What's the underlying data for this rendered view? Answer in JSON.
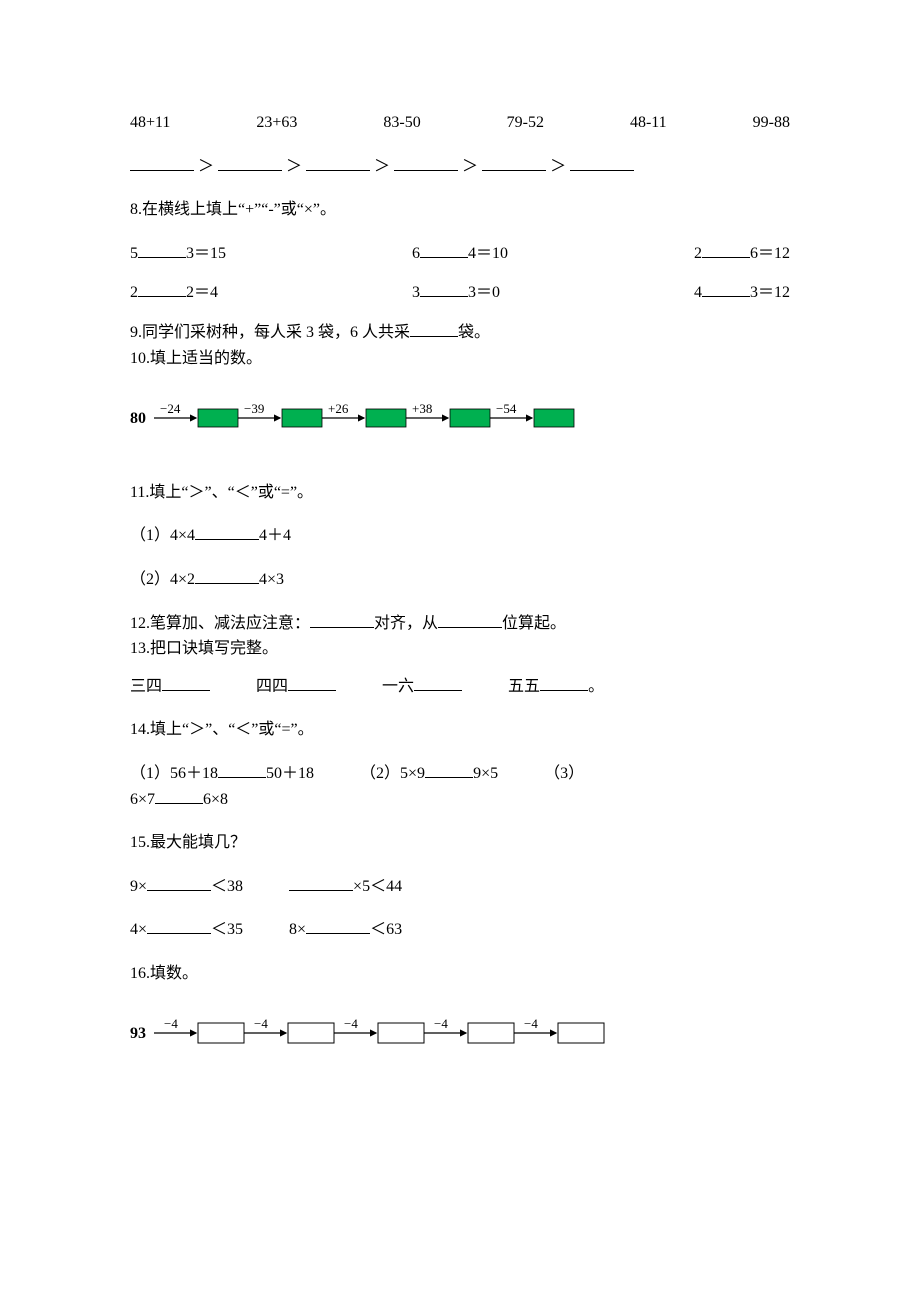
{
  "q7": {
    "items": [
      "48+11",
      "23+63",
      "83-50",
      "79-52",
      "48-11",
      "99-88"
    ],
    "gt": "＞"
  },
  "q8": {
    "prompt": "8.在横线上填上“+”“-”或“×”。",
    "row1": [
      {
        "a": "5",
        "b": "3",
        "r": "15"
      },
      {
        "a": "6",
        "b": "4",
        "r": "10"
      },
      {
        "a": "2",
        "b": "6",
        "r": "12"
      }
    ],
    "row2": [
      {
        "a": "2",
        "b": "2",
        "r": "4"
      },
      {
        "a": "3",
        "b": "3",
        "r": "0"
      },
      {
        "a": "4",
        "b": "3",
        "r": "12"
      }
    ],
    "eq": "＝"
  },
  "q9": {
    "text_before": "9.同学们采树种，每人采 3 袋，6 人共采",
    "text_after": "袋。"
  },
  "q10": {
    "prompt": "10.填上适当的数。",
    "start": "80",
    "ops": [
      "−24",
      "−39",
      "+26",
      "+38",
      "−54"
    ]
  },
  "q11": {
    "prompt": "11.填上“＞”、“＜”或“=”。",
    "line1_left": "（1）4×4",
    "line1_right": "4＋4",
    "line2_left": "（2）4×2",
    "line2_right": "4×3"
  },
  "q12": {
    "before1": "12.笔算加、减法应注意：",
    "mid": "对齐，从",
    "after": "位算起。"
  },
  "q13": {
    "prompt": "13.把口诀填写完整。",
    "items": [
      "三四",
      "四四",
      "一六",
      "五五"
    ],
    "period": "。"
  },
  "q14": {
    "prompt": "14.填上“＞”、“＜”或“=”。",
    "p1_left": "（1）56＋18",
    "p1_right": "50＋18",
    "p2_left": "（2）5×9",
    "p2_right": "9×5",
    "p3_left": "（3）",
    "p3_a": "6×7",
    "p3_b": "6×8"
  },
  "q15": {
    "prompt": "15.最大能填几？",
    "r1a_left": "9×",
    "r1a_right": "＜38",
    "r1b_right": "×5＜44",
    "r2a_left": "4×",
    "r2a_right": "＜35",
    "r2b_left": "8×",
    "r2b_right": "＜63"
  },
  "q16": {
    "prompt": "16.填数。",
    "start": "93",
    "op": "−4"
  }
}
